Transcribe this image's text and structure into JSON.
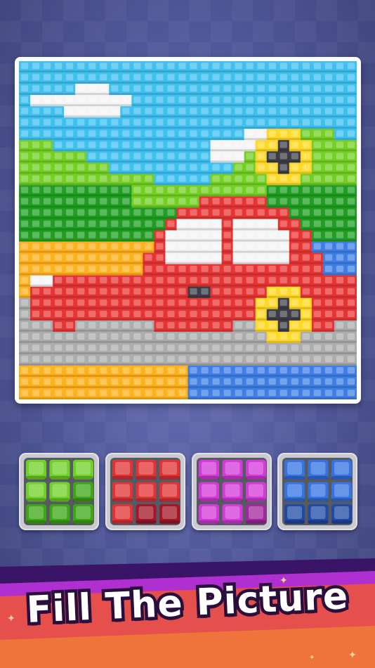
{
  "banner": {
    "text": "Fill The Picture"
  },
  "colors": {
    "sky": "#3ec0f0",
    "cloud": "#f4f4f4",
    "green_light": "#74cf25",
    "green_dark": "#1f9f22",
    "orange": "#ffb01a",
    "blue": "#3f7fe4",
    "red": "#e63434",
    "grey": "#acacac",
    "yellow": "#ffd825",
    "dark": "#3c3c46"
  },
  "palettes": [
    {
      "name": "green",
      "cells": [
        "#6fd128",
        "#6fd128",
        "#6fd128",
        "#6fd128",
        "#6fd128",
        "#3da616",
        "#3da616",
        "#3da616",
        "#3da616"
      ]
    },
    {
      "name": "red",
      "cells": [
        "#e13336",
        "#e13336",
        "#e13336",
        "#e13336",
        "#e13336",
        "#e13336",
        "#e13336",
        "#a51627",
        "#a51627"
      ]
    },
    {
      "name": "magenta",
      "cells": [
        "#d33ad8",
        "#d33ad8",
        "#d33ad8",
        "#d33ad8",
        "#d33ad8",
        "#d33ad8",
        "#d33ad8",
        "#d33ad8",
        "#a3269e"
      ]
    },
    {
      "name": "blue",
      "cells": [
        "#3573e0",
        "#3573e0",
        "#3573e0",
        "#3573e0",
        "#3573e0",
        "#3573e0",
        "#1f4aa6",
        "#1f4aa6",
        "#1f4aa6"
      ]
    }
  ]
}
